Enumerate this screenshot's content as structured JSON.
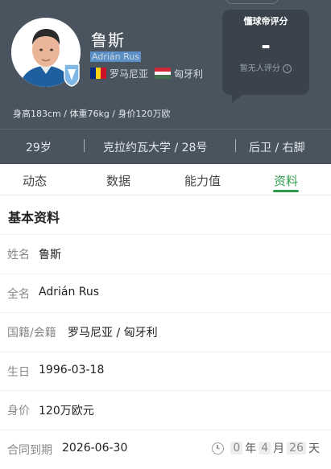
{
  "player": {
    "name": "鲁斯",
    "latin_name": "Adrián Rus",
    "nationality_1": "罗马尼亚",
    "nationality_2": "匈牙利",
    "stats_line": "身高183cm / 体重76kg / 身价120万欧",
    "age": "29岁",
    "club_number": "克拉约瓦大学 / 28号",
    "position_foot": "后卫 / 右脚"
  },
  "rating": {
    "title": "懂球帝评分",
    "score": "-",
    "note": "暂无人评分",
    "info_glyph": "i"
  },
  "tabs": [
    "动态",
    "数据",
    "能力值",
    "资料"
  ],
  "active_tab": "资料",
  "section_title": "基本资料",
  "info_rows": [
    {
      "label": "姓名",
      "value": "鲁斯"
    },
    {
      "label": "全名",
      "value": "Adrián Rus"
    },
    {
      "label": "国籍/会籍",
      "value": "罗马尼亚 / 匈牙利"
    },
    {
      "label": "生日",
      "value": "1996-03-18"
    },
    {
      "label": "身价",
      "value": "120万欧元"
    },
    {
      "label": "合同到期",
      "value": "2026-06-30"
    }
  ],
  "contract_countdown": {
    "years": "0",
    "year_unit": "年",
    "months": "4",
    "month_unit": "月",
    "days": "26",
    "day_unit": "天"
  },
  "colors": {
    "header_bg": "#49545f",
    "accent_green": "#2e9e4d",
    "romania_flag": [
      "#002B7F",
      "#FCD116",
      "#CE1126"
    ],
    "hungary_flag": [
      "#CE2939",
      "#FFFFFF",
      "#477050"
    ]
  },
  "icons": [
    "avatar",
    "club-badge-icon",
    "romania-flag-icon",
    "hungary-flag-icon",
    "info-icon",
    "clock-icon"
  ]
}
